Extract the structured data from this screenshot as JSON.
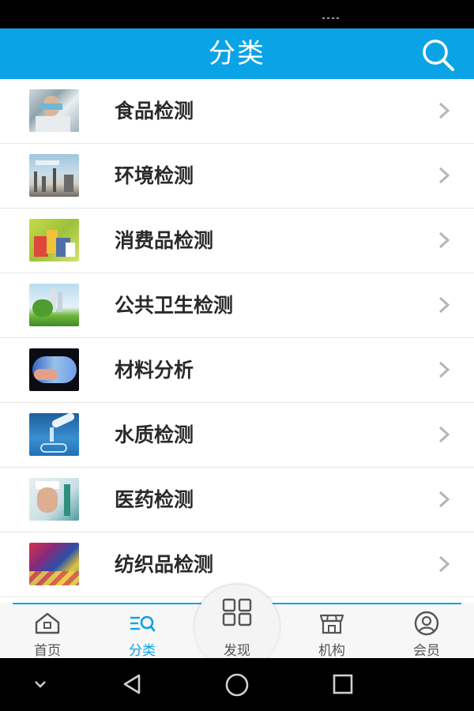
{
  "header": {
    "title": "分类"
  },
  "categories": [
    {
      "label": "食品检测"
    },
    {
      "label": "环境检测"
    },
    {
      "label": "消费品检测"
    },
    {
      "label": "公共卫生检测"
    },
    {
      "label": "材料分析"
    },
    {
      "label": "水质检测"
    },
    {
      "label": "医药检测"
    },
    {
      "label": "纺织品检测"
    }
  ],
  "tabs": [
    {
      "label": "首页",
      "icon": "home-icon"
    },
    {
      "label": "分类",
      "icon": "category-icon",
      "active": true
    },
    {
      "label": "发现",
      "icon": "grid-icon"
    },
    {
      "label": "机构",
      "icon": "store-icon"
    },
    {
      "label": "会员",
      "icon": "user-icon"
    }
  ],
  "colors": {
    "accent": "#0aa3e6",
    "text": "#2a2a2a",
    "muted": "#555555"
  }
}
